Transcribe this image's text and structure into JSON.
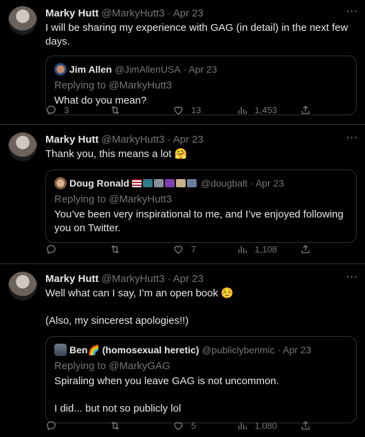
{
  "tweets": [
    {
      "author": "Marky Hutt",
      "handle": "@MarkyHutt3",
      "date": "· Apr 23",
      "text": "I will be sharing my experience with GAG (in detail) in the next few days.",
      "quote": {
        "author": "Jim Allen",
        "handle": "@JimAllenUSA",
        "date": "· Apr 23",
        "reply": "Replying to @MarkyHutt3",
        "text": "What do you mean?"
      },
      "stats": {
        "replies": "3",
        "retweets": "",
        "likes": "13",
        "views": "1,453"
      }
    },
    {
      "author": "Marky Hutt",
      "handle": "@MarkyHutt3",
      "date": "· Apr 23",
      "text": "Thank you, this means a lot 🤗",
      "quote": {
        "author": "Doug Ronald",
        "handle": "@dougbalt",
        "date": "· Apr 23",
        "reply": "Replying to @MarkyHutt3",
        "text": "You’ve been very inspirational to me, and I’ve enjoyed following you on Twitter."
      },
      "stats": {
        "replies": "",
        "retweets": "",
        "likes": "7",
        "views": "1,108"
      }
    },
    {
      "author": "Marky Hutt",
      "handle": "@MarkyHutt3",
      "date": "· Apr 23",
      "text": "Well what can I say, I’m an open book ☺️\n\n(Also, my sincerest apologies!!)",
      "quote": {
        "author": "Ben🌈 (homosexual heretic)",
        "handle": "@publiclybenmic",
        "date": "· Apr 23",
        "reply": "Replying to @MarkyGAG",
        "text": "Spiraling when you leave GAG is not uncommon.\n\nI did... but not so publicly lol"
      },
      "stats": {
        "replies": "",
        "retweets": "",
        "likes": "5",
        "views": "1,080"
      }
    }
  ],
  "ui": {
    "more": "···"
  },
  "icons": {
    "reply": "reply-icon",
    "retweet": "retweet-icon",
    "like": "heart-icon",
    "views": "views-icon",
    "share": "share-icon"
  },
  "colors": {
    "background": "#000000",
    "text": "#e7e9ea",
    "muted": "#71767b",
    "border": "#2f3336"
  }
}
